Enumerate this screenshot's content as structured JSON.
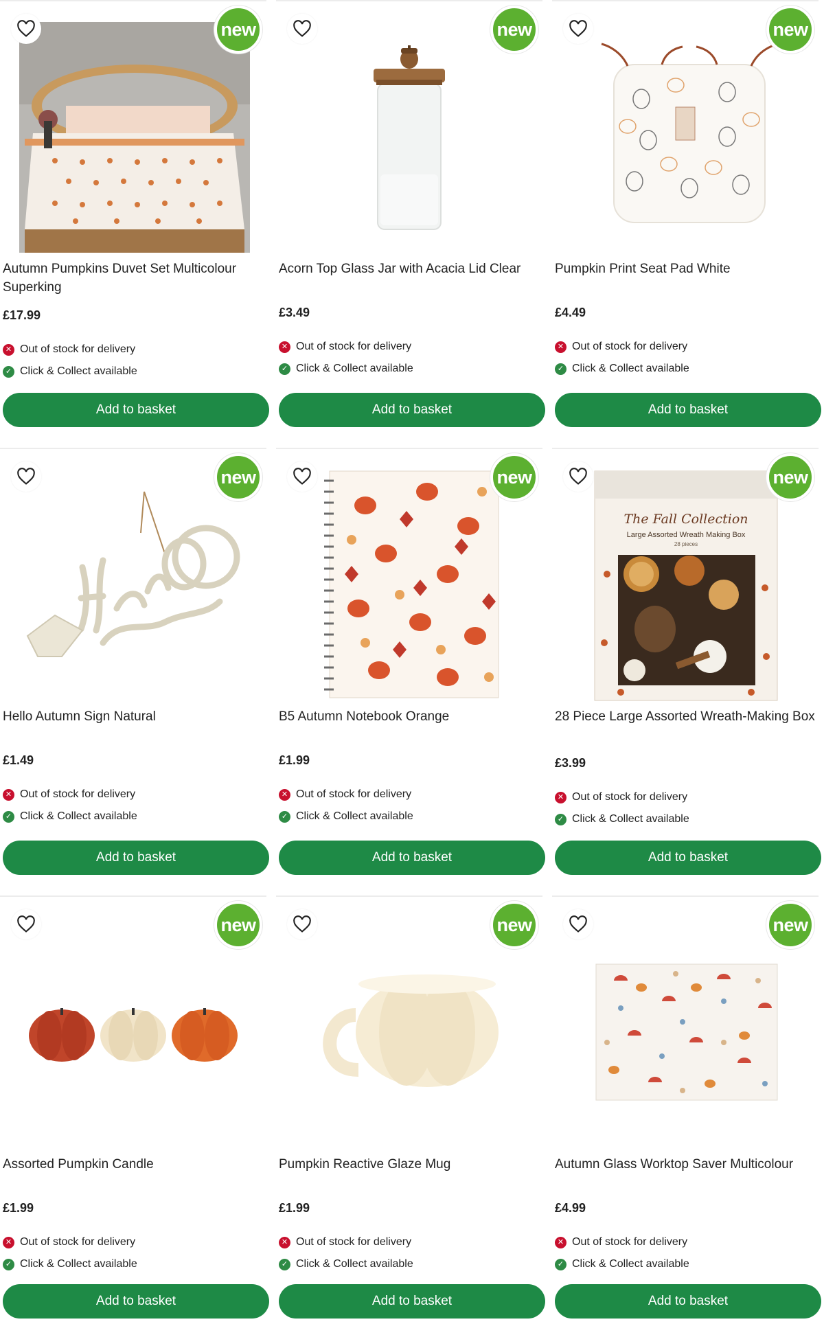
{
  "products": [
    {
      "name": "Autumn Pumpkins Duvet Set Multicolour Superking",
      "price": "£17.99",
      "badge": "new",
      "delivery": "Out of stock for delivery",
      "collect": "Click & Collect available",
      "button": "Add to basket"
    },
    {
      "name": "Acorn Top Glass Jar with Acacia Lid Clear",
      "price": "£3.49",
      "badge": "new",
      "delivery": "Out of stock for delivery",
      "collect": "Click & Collect available",
      "button": "Add to basket"
    },
    {
      "name": "Pumpkin Print Seat Pad White",
      "price": "£4.49",
      "badge": "new",
      "delivery": "Out of stock for delivery",
      "collect": "Click & Collect available",
      "button": "Add to basket"
    },
    {
      "name": "Hello Autumn Sign Natural",
      "price": "£1.49",
      "badge": "new",
      "delivery": "Out of stock for delivery",
      "collect": "Click & Collect available",
      "button": "Add to basket"
    },
    {
      "name": "B5 Autumn Notebook Orange",
      "price": "£1.99",
      "badge": "new",
      "delivery": "Out of stock for delivery",
      "collect": "Click & Collect available",
      "button": "Add to basket"
    },
    {
      "name": "28 Piece Large Assorted Wreath-Making Box",
      "price": "£3.99",
      "badge": "new",
      "delivery": "Out of stock for delivery",
      "collect": "Click & Collect available",
      "button": "Add to basket",
      "packaging_text": {
        "heading": "The Fall Collection",
        "sub": "Large Assorted Wreath Making Box",
        "count": "28 pieces"
      }
    },
    {
      "name": "Assorted Pumpkin Candle",
      "price": "£1.99",
      "badge": "new",
      "delivery": "Out of stock for delivery",
      "collect": "Click & Collect available",
      "button": "Add to basket"
    },
    {
      "name": "Pumpkin Reactive Glaze Mug",
      "price": "£1.99",
      "badge": "new",
      "delivery": "Out of stock for delivery",
      "collect": "Click & Collect available",
      "button": "Add to basket"
    },
    {
      "name": "Autumn Glass Worktop Saver Multicolour",
      "price": "£4.99",
      "badge": "new",
      "delivery": "Out of stock for delivery",
      "collect": "Click & Collect available",
      "button": "Add to basket"
    }
  ],
  "icons": {
    "favourite": "heart-outline-icon",
    "out_of_stock": "cross-circle-icon",
    "available": "check-circle-icon"
  },
  "colors": {
    "button_green": "#1e8a46",
    "badge_green": "#5cb030",
    "out_of_stock_red": "#c8102e",
    "available_green": "#2e8b45"
  }
}
